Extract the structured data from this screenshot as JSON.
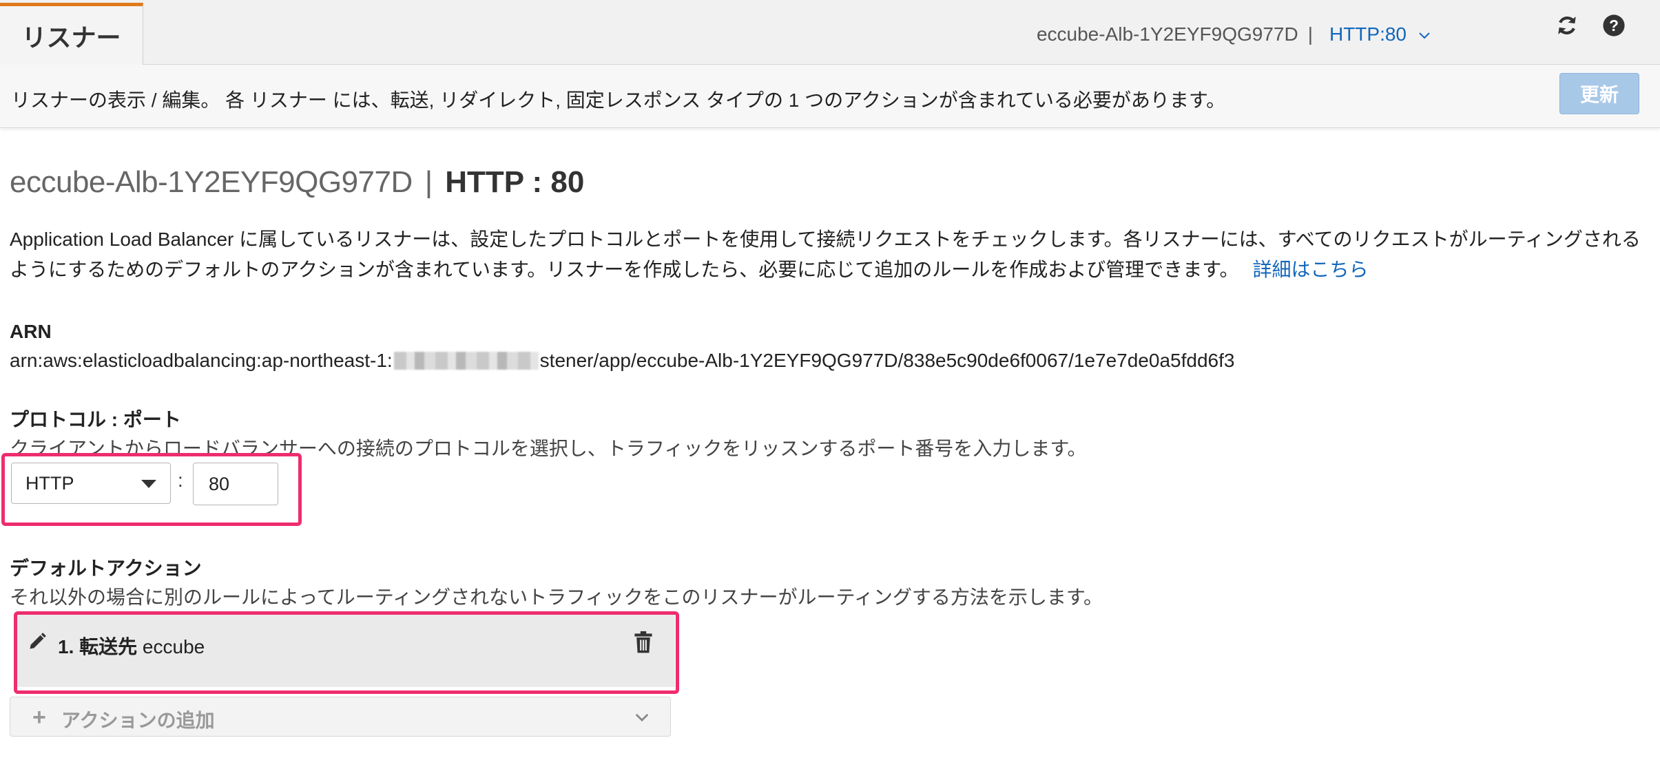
{
  "tab": {
    "label": "リスナー"
  },
  "header_crumb": {
    "load_balancer": "eccube-Alb-1Y2EYF9QG977D",
    "separator": "|",
    "listener": "HTTP:80"
  },
  "icons": {
    "refresh": "refresh-icon",
    "help": "help-icon",
    "edit": "pencil-icon",
    "delete": "trash-icon",
    "add": "plus-icon",
    "expand": "chevron-down-icon"
  },
  "infobar": {
    "message": "リスナーの表示 / 編集。 各 リスナー には、転送, リダイレクト, 固定レスポンス タイプの 1 つのアクションが含まれている必要があります。",
    "update_label": "更新"
  },
  "main": {
    "lb_name": "eccube-Alb-1Y2EYF9QG977D",
    "title_sep": "|",
    "protocol_port": "HTTP : 80",
    "description": "Application Load Balancer に属しているリスナーは、設定したプロトコルとポートを使用して接続リクエストをチェックします。各リスナーには、すべてのリクエストがルーティングされるようにするためのデフォルトのアクションが含まれています。リスナーを作成したら、必要に応じて追加のルールを作成および管理できます。",
    "learn_more": "詳細はこちら",
    "arn_label": "ARN",
    "arn_prefix": "arn:aws:elasticloadbalancing:ap-northeast-1:",
    "arn_suffix": "stener/app/eccube-Alb-1Y2EYF9QG977D/838e5c90de6f0067/1e7e7de0a5fdd6f3",
    "protocol_label": "プロトコル : ポート",
    "protocol_help": "クライアントからロードバランサーへの接続のプロトコルを選択し、トラフィックをリッスンするポート番号を入力します。",
    "protocol_value": "HTTP",
    "colon": ":",
    "port_value": "80",
    "default_action_label": "デフォルトアクション",
    "default_action_help": "それ以外の場合に別のルールによってルーティングされないトラフィックをこのリスナーがルーティングする方法を示します。",
    "action_number": "1. 転送先",
    "action_target": "eccube",
    "add_action_label": "アクションの追加"
  },
  "colors": {
    "tab_accent": "#e07b1c",
    "link": "#1166bb",
    "highlight": "#ee2d6e",
    "update_button": "#a8c8e8"
  }
}
